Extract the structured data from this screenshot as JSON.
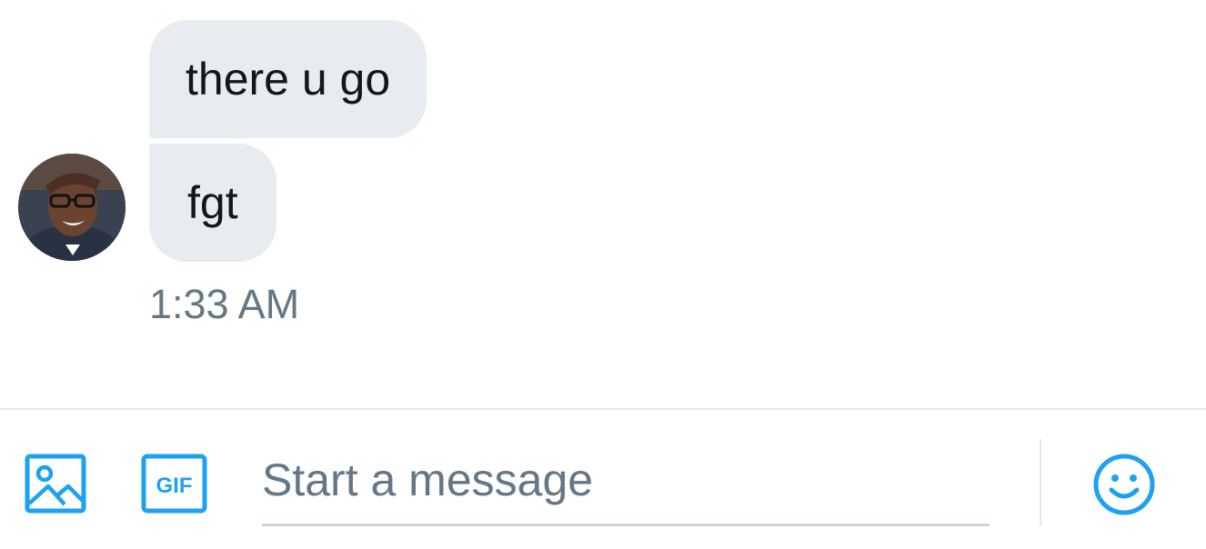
{
  "messages": [
    {
      "text": "there u go"
    },
    {
      "text": "fgt"
    }
  ],
  "timestamp": "1:33 AM",
  "avatar": {
    "icon": "user-avatar-photo"
  },
  "composer": {
    "placeholder": "Start a message",
    "media_icon": "image-icon",
    "gif_label": "GIF",
    "emoji_icon": "smiley-icon",
    "accent_color": "#1da1f2"
  },
  "colors": {
    "bubble": "#e6ecf0",
    "text": "#14171a",
    "muted": "#657786"
  }
}
